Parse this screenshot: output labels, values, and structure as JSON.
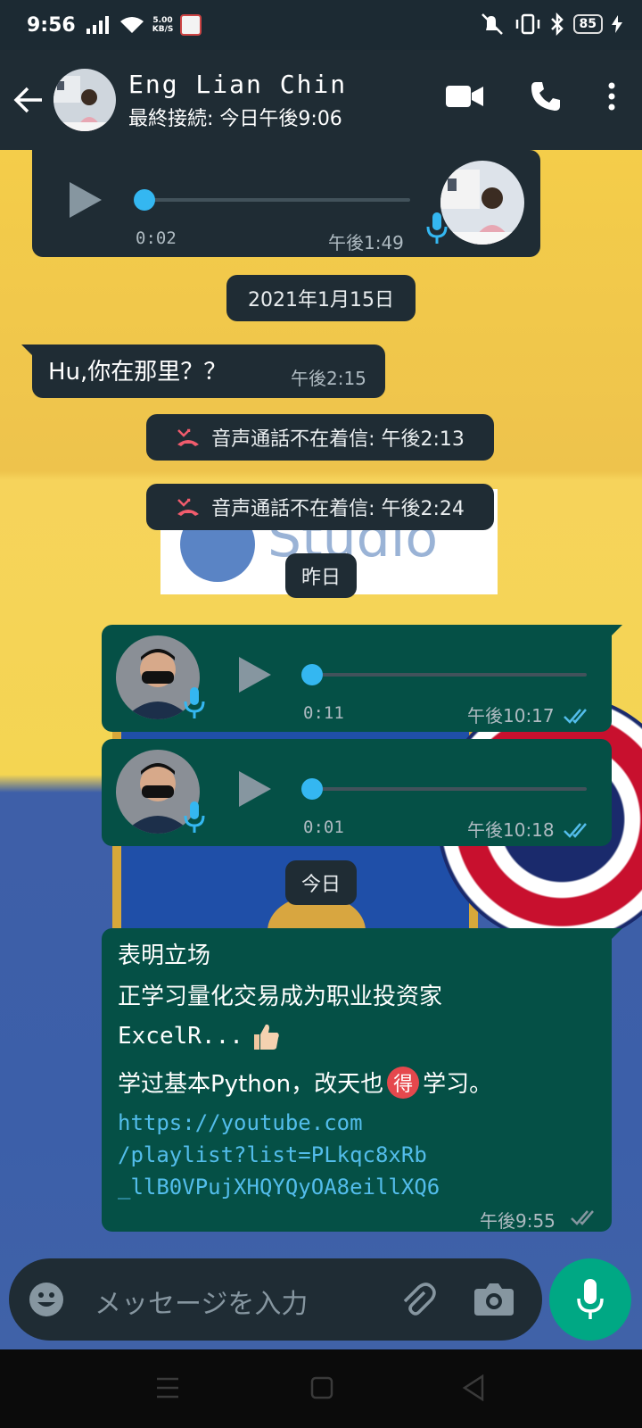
{
  "status_bar": {
    "time": "9:56",
    "speed_value": "5.00",
    "speed_unit": "KB/S",
    "battery": "85"
  },
  "header": {
    "contact_name": "Eng Lian Chin",
    "last_seen": "最終接続: 今日午後9:06"
  },
  "messages": {
    "voice_in": {
      "duration": "0:02",
      "time": "午後1:49"
    },
    "date_pill_1": "2021年1月15日",
    "text_in": {
      "text": "Hu,你在那里？？",
      "time": "午後2:15"
    },
    "missed_call_1": "音声通話不在着信: 午後2:13",
    "missed_call_2": "音声通話不在着信: 午後2:24",
    "date_pill_2": "昨日",
    "voice_out_1": {
      "duration": "0:11",
      "time": "午後10:17"
    },
    "voice_out_2": {
      "duration": "0:01",
      "time": "午後10:18"
    },
    "date_pill_3": "今日",
    "text_out": {
      "line1": "表明立场",
      "line2": "正学习量化交易成为职业投资家",
      "line3": "ExcelR...",
      "line4_a": "学过基本Python，改天也",
      "line4_emoji": "得",
      "line4_b": "学习。",
      "link_1": "https://youtube.com",
      "link_2": "/playlist?list=PLkqc8xRb",
      "link_3": "_llB0VPujXHQYQyOA8eillXQ6",
      "time": "午後9:55"
    }
  },
  "wallpaper": {
    "logo_text": "Studio"
  },
  "input": {
    "placeholder": "メッセージを入力"
  },
  "colors": {
    "accent_green": "#00a884",
    "link_blue": "#53bdeb",
    "read_tick_blue": "#53bdeb"
  }
}
